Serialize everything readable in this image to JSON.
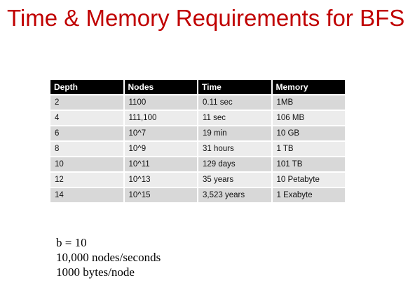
{
  "slide": {
    "title": "Time & Memory Requirements for BFS"
  },
  "table": {
    "headers": [
      "Depth",
      "Nodes",
      "Time",
      "Memory"
    ],
    "rows": [
      [
        "2",
        "1100",
        "0.11 sec",
        "1MB"
      ],
      [
        "4",
        "111,100",
        "11 sec",
        "106 MB"
      ],
      [
        "6",
        "10^7",
        "19 min",
        "10 GB"
      ],
      [
        "8",
        "10^9",
        "31 hours",
        "1 TB"
      ],
      [
        "10",
        "10^11",
        "129 days",
        "101 TB"
      ],
      [
        "12",
        "10^13",
        "35 years",
        "10 Petabyte"
      ],
      [
        "14",
        "10^15",
        "3,523 years",
        "1 Exabyte"
      ]
    ]
  },
  "params": {
    "branching": "b = 10",
    "speed": "10,000 nodes/seconds",
    "memory": "1000 bytes/node"
  }
}
